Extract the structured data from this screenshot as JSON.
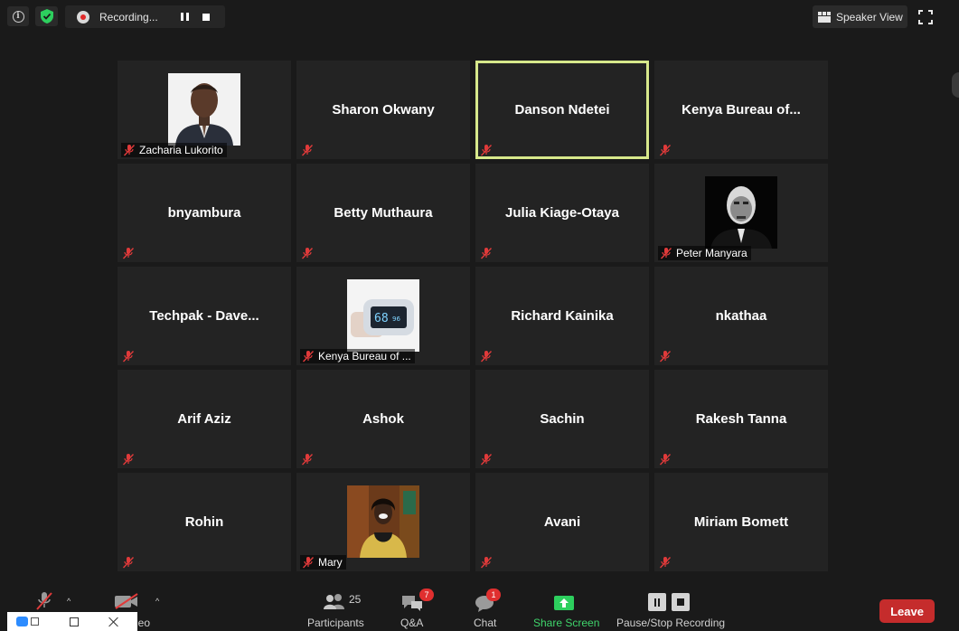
{
  "topbar": {
    "recording_label": "Recording...",
    "speaker_view_label": "Speaker View"
  },
  "tiles": [
    {
      "name": "",
      "label": "Zacharia Lukorito",
      "photo": "man-portrait",
      "active": false
    },
    {
      "name": "Sharon Okwany",
      "label": "",
      "photo": "",
      "active": false
    },
    {
      "name": "Danson Ndetei",
      "label": "",
      "photo": "",
      "active": true
    },
    {
      "name": "Kenya Bureau of...",
      "label": "",
      "photo": "",
      "active": false
    },
    {
      "name": "bnyambura",
      "label": "",
      "photo": "",
      "active": false
    },
    {
      "name": "Betty Muthaura",
      "label": "",
      "photo": "",
      "active": false
    },
    {
      "name": "Julia Kiage-Otaya",
      "label": "",
      "photo": "",
      "active": false
    },
    {
      "name": "",
      "label": "Peter Manyara",
      "photo": "bw-portrait",
      "active": false
    },
    {
      "name": "Techpak - Dave...",
      "label": "",
      "photo": "",
      "active": false
    },
    {
      "name": "",
      "label": "Kenya Bureau of ...",
      "photo": "oximeter",
      "active": false
    },
    {
      "name": "Richard Kainika",
      "label": "",
      "photo": "",
      "active": false
    },
    {
      "name": "nkathaa",
      "label": "",
      "photo": "",
      "active": false
    },
    {
      "name": "Arif Aziz",
      "label": "",
      "photo": "",
      "active": false
    },
    {
      "name": "Ashok",
      "label": "",
      "photo": "",
      "active": false
    },
    {
      "name": "Sachin",
      "label": "",
      "photo": "",
      "active": false
    },
    {
      "name": "Rakesh Tanna",
      "label": "",
      "photo": "",
      "active": false
    },
    {
      "name": "Rohin",
      "label": "",
      "photo": "",
      "active": false
    },
    {
      "name": "",
      "label": "Mary",
      "photo": "woman-portrait",
      "active": false
    },
    {
      "name": "Avani",
      "label": "",
      "photo": "",
      "active": false
    },
    {
      "name": "Miriam Bomett",
      "label": "",
      "photo": "",
      "active": false
    }
  ],
  "toolbar": {
    "video_label": "deo",
    "participants_label": "Participants",
    "participants_count": "25",
    "qa_label": "Q&A",
    "qa_badge": "7",
    "chat_label": "Chat",
    "chat_badge": "1",
    "share_label": "Share Screen",
    "recording_label": "Pause/Stop Recording",
    "leave_label": "Leave"
  },
  "colors": {
    "background": "#1a1a1a",
    "tile": "#232323",
    "active_border": "#d7e88b",
    "share_green": "#2dcf5e",
    "leave_red": "#c52c2c",
    "badge_red": "#e02f2f",
    "mute_red": "#e03a3a"
  }
}
